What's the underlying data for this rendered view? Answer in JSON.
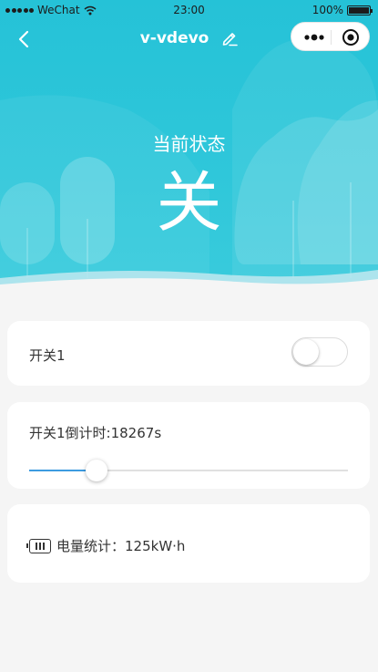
{
  "status_bar": {
    "carrier": "WeChat",
    "time": "23:00",
    "battery": "100%"
  },
  "nav": {
    "title": "v-vdevo"
  },
  "hero": {
    "state_label": "当前状态",
    "state_value": "关"
  },
  "switch1": {
    "label": "开关1",
    "on": false
  },
  "countdown": {
    "label": "开关1倒计时:18267s",
    "slider_fraction": 0.21
  },
  "energy": {
    "label": "电量统计：125kW·h",
    "icon": "battery-icon"
  },
  "colors": {
    "hero": "#25c2d7",
    "slider_fill": "#3d9be0"
  }
}
